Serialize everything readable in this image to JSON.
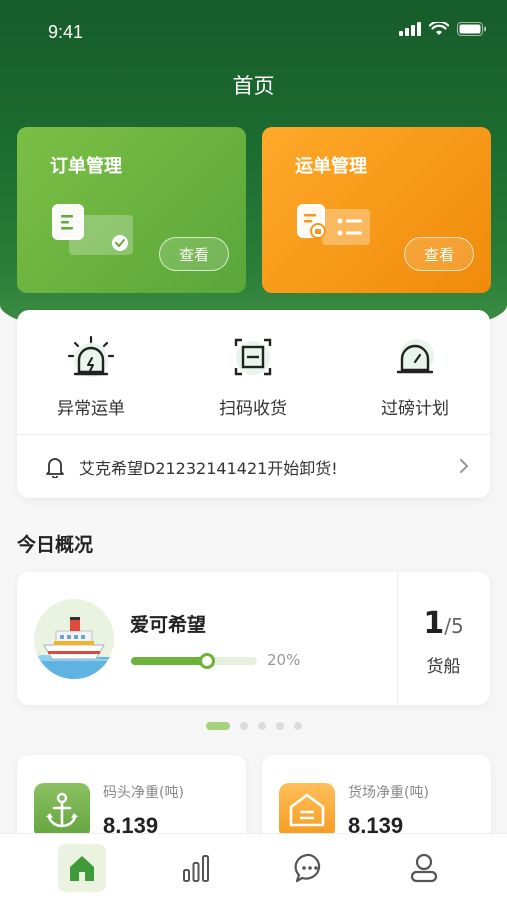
{
  "status_bar": {
    "time": "9:41"
  },
  "header": {
    "title": "首页"
  },
  "cards": {
    "order": {
      "title": "订单管理",
      "button": "查看",
      "color": "#62a83c"
    },
    "waybill": {
      "title": "运单管理",
      "button": "查看",
      "color": "#f7961a"
    }
  },
  "quick_actions": [
    {
      "label": "异常运单",
      "icon": "alarm-icon"
    },
    {
      "label": "扫码收货",
      "icon": "scan-icon"
    },
    {
      "label": "过磅计划",
      "icon": "scale-icon"
    }
  ],
  "notice": {
    "text": "艾克希望D21232141421开始卸货!",
    "icon": "bell-icon"
  },
  "overview": {
    "title": "今日概况",
    "ship": {
      "name": "爱可希望",
      "progress": 0.2,
      "progress_label": "20%",
      "count_current": "1",
      "count_total": "/5",
      "unit": "货船"
    },
    "carousel": {
      "pages": 5,
      "active": 0
    }
  },
  "stats": [
    {
      "label": "码头净重(吨)",
      "value": "8,139",
      "icon": "anchor-icon"
    },
    {
      "label": "货场净重(吨)",
      "value": "8,139",
      "icon": "warehouse-icon"
    }
  ],
  "tabbar": [
    {
      "name": "home-icon",
      "active": true
    },
    {
      "name": "stats-icon",
      "active": false
    },
    {
      "name": "message-icon",
      "active": false
    },
    {
      "name": "profile-icon",
      "active": false
    }
  ],
  "colors": {
    "primary": "#1d6d30",
    "accent_green": "#6cb33a",
    "accent_orange": "#f7961a"
  }
}
